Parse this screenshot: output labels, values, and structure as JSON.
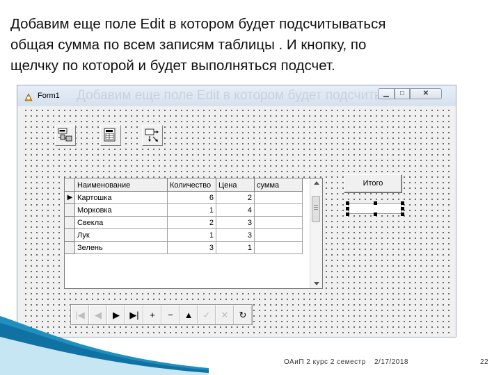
{
  "slide": {
    "text_line1": "Добавим еще поле Edit в котором будет подсчитываться",
    "text_line2": "общая сумма по всем записям таблицы . И кнопку, по",
    "text_line3": "щелчку по которой и будет выполняться подсчет."
  },
  "window": {
    "title": "Form1",
    "min_glyph": "▁",
    "max_glyph": "□",
    "close_glyph": "✕"
  },
  "components": [
    {
      "name": "ado-connection-icon"
    },
    {
      "name": "ado-table-icon"
    },
    {
      "name": "datasource-icon"
    }
  ],
  "grid": {
    "columns": [
      "Наименование",
      "Количество",
      "Цена",
      "сумма"
    ],
    "rows": [
      {
        "name": "Картошка",
        "qty": "6",
        "price": "2",
        "sum": ""
      },
      {
        "name": "Морковка",
        "qty": "1",
        "price": "4",
        "sum": ""
      },
      {
        "name": "Свекла",
        "qty": "2",
        "price": "3",
        "sum": ""
      },
      {
        "name": "Лук",
        "qty": "1",
        "price": "3",
        "sum": ""
      },
      {
        "name": "Зелень",
        "qty": "3",
        "price": "1",
        "sum": ""
      }
    ],
    "current_row_marker": "▶"
  },
  "itogo_button": {
    "label": "Итого"
  },
  "navigator": [
    {
      "name": "first-record-button",
      "glyph": "|◀",
      "enabled": false
    },
    {
      "name": "prior-record-button",
      "glyph": "◀",
      "enabled": false
    },
    {
      "name": "next-record-button",
      "glyph": "▶",
      "enabled": true
    },
    {
      "name": "last-record-button",
      "glyph": "▶|",
      "enabled": true
    },
    {
      "name": "insert-record-button",
      "glyph": "+",
      "enabled": true
    },
    {
      "name": "delete-record-button",
      "glyph": "−",
      "enabled": true
    },
    {
      "name": "edit-record-button",
      "glyph": "▲",
      "enabled": true
    },
    {
      "name": "post-record-button",
      "glyph": "✓",
      "enabled": false
    },
    {
      "name": "cancel-record-button",
      "glyph": "✕",
      "enabled": false
    },
    {
      "name": "refresh-records-button",
      "glyph": "↻",
      "enabled": true
    }
  ],
  "footer": {
    "course": "ОАиП 2 курс 2 семестр",
    "date": "2/17/2018",
    "page": "22"
  }
}
